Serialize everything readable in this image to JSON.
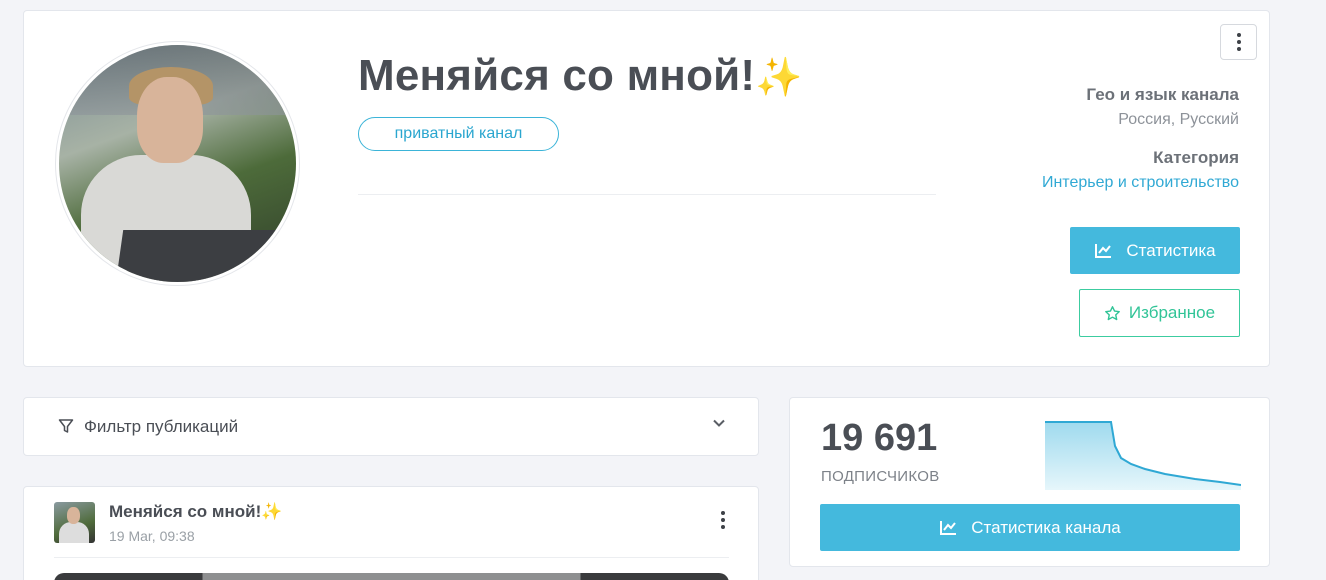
{
  "channel": {
    "title": "Меняйся со мной!",
    "title_emoji": "✨",
    "privacy_badge": "приватный канал",
    "geo_label": "Гео и язык канала",
    "geo_value": "Россия, Русский",
    "category_label": "Категория",
    "category_value": "Интерьер и строительство",
    "stats_button": "Статистика",
    "favorite_button": "Избранное"
  },
  "filter": {
    "label": "Фильтр публикаций"
  },
  "post": {
    "title": "Меняйся со мной!",
    "title_emoji": "✨",
    "date": "19 Mar, 09:38"
  },
  "stats": {
    "subscribers": "19 691",
    "subscribers_label": "ПОДПИСЧИКОВ",
    "channel_stats_button": "Статистика канала"
  },
  "colors": {
    "accent": "#44b9dd",
    "favorite": "#31c497",
    "background": "#f3f4f8"
  }
}
